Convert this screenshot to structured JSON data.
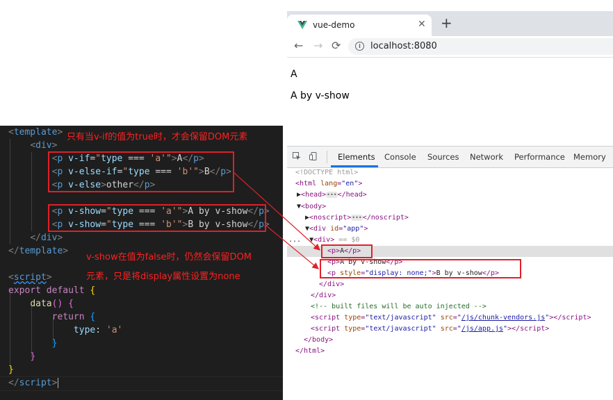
{
  "browser": {
    "tab_title": "vue-demo",
    "tab_close": "✕",
    "new_tab": "+",
    "back": "←",
    "forward": "→",
    "reload": "⟳",
    "url": "localhost:8080",
    "info_glyph": "i"
  },
  "page": {
    "line1": "A",
    "line2": "A by v-show"
  },
  "devtools": {
    "tabs": [
      "Elements",
      "Console",
      "Sources",
      "Network",
      "Performance",
      "Memory"
    ],
    "active_tab": "Elements",
    "eq": "== $0",
    "dots": "..."
  },
  "annotations": {
    "top": "只有当v-if的值为true时，才会保留DOM元素",
    "middle_1": "v-show在值为false时，仍然会保留DOM",
    "middle_2": "元素，只是将display属性设置为none"
  },
  "colors": {
    "annotation": "#ff2020",
    "editor_bg": "#1e1e1e",
    "tab_accent": "#1a73e8"
  }
}
